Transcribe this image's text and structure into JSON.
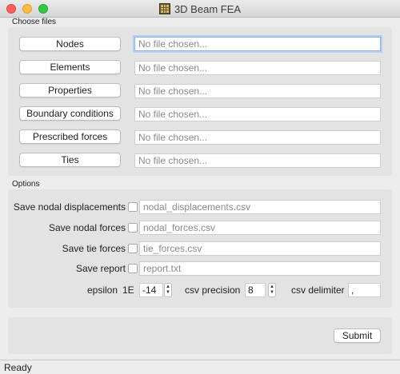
{
  "window": {
    "title": "3D Beam FEA"
  },
  "files": {
    "group_label": "Choose files",
    "rows": [
      {
        "button": "Nodes",
        "placeholder": "No file chosen..."
      },
      {
        "button": "Elements",
        "placeholder": "No file chosen..."
      },
      {
        "button": "Properties",
        "placeholder": "No file chosen..."
      },
      {
        "button": "Boundary conditions",
        "placeholder": "No file chosen..."
      },
      {
        "button": "Prescribed forces",
        "placeholder": "No file chosen..."
      },
      {
        "button": "Ties",
        "placeholder": "No file chosen..."
      }
    ]
  },
  "options": {
    "group_label": "Options",
    "rows": [
      {
        "label": "Save nodal displacements",
        "checked": false,
        "placeholder": "nodal_displacements.csv"
      },
      {
        "label": "Save nodal forces",
        "checked": false,
        "placeholder": "nodal_forces.csv"
      },
      {
        "label": "Save tie forces",
        "checked": false,
        "placeholder": "tie_forces.csv"
      },
      {
        "label": "Save report",
        "checked": false,
        "placeholder": "report.txt"
      }
    ],
    "epsilon_label": "epsilon",
    "epsilon_prefix": "1E",
    "epsilon_value": "-14",
    "precision_label": "csv precision",
    "precision_value": "8",
    "delimiter_label": "csv delimiter",
    "delimiter_value": ","
  },
  "actions": {
    "submit_label": "Submit"
  },
  "status": {
    "text": "Ready"
  }
}
